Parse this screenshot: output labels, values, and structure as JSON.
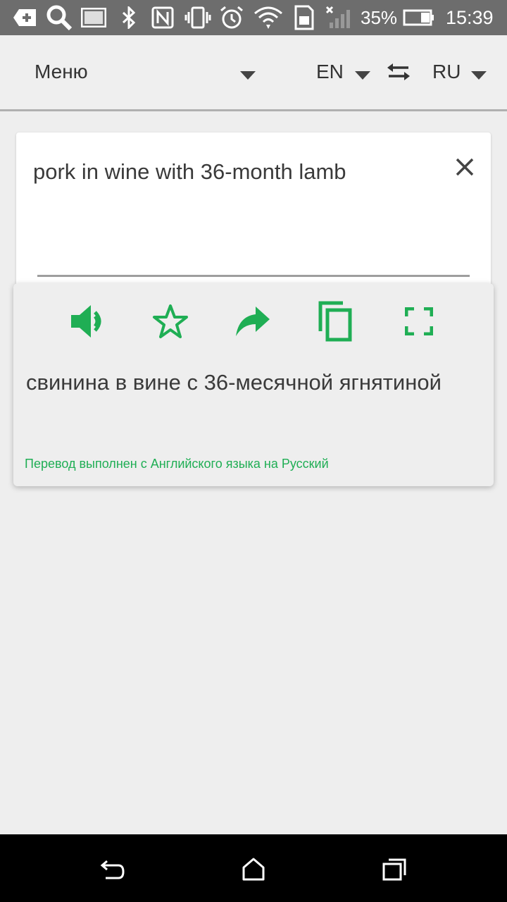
{
  "status_bar": {
    "battery_percent": "35%",
    "time": "15:39",
    "icons": [
      "add-box-icon",
      "search-icon",
      "image-icon",
      "bluetooth-icon",
      "nfc-icon",
      "vibrate-icon",
      "alarm-icon",
      "wifi-icon",
      "sim-icon",
      "signal-icon",
      "battery-icon"
    ]
  },
  "toolbar": {
    "menu_label": "Меню",
    "source_lang": "EN",
    "target_lang": "RU"
  },
  "input": {
    "text": "pork in wine with 36-month lamb"
  },
  "result": {
    "translation": "свинина в вине с 36-месячной ягнятиной",
    "note": "Перевод выполнен с Английского языка на Русский",
    "actions": [
      "speaker-icon",
      "star-icon",
      "share-icon",
      "copy-icon",
      "fullscreen-icon"
    ]
  },
  "colors": {
    "accent": "#1fae54",
    "status_bar": "#6d6d6d",
    "background": "#eeeeee"
  }
}
